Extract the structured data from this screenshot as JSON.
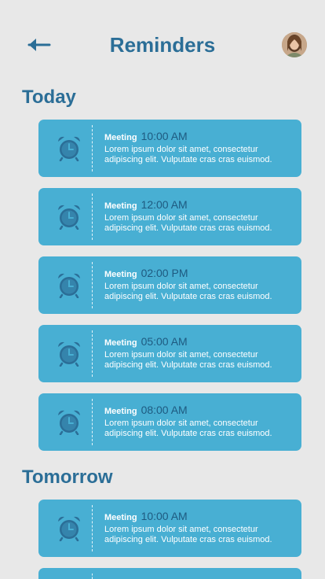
{
  "header": {
    "title": "Reminders",
    "back_icon": "arrow-left-icon",
    "avatar_icon": "user-avatar"
  },
  "sections": [
    {
      "title": "Today",
      "items": [
        {
          "label": "Meeting",
          "time": "10:00 AM",
          "desc": "Lorem ipsum dolor sit amet, consectetur adipiscing elit. Vulputate cras cras euismod."
        },
        {
          "label": "Meeting",
          "time": "12:00 AM",
          "desc": "Lorem ipsum dolor sit amet, consectetur adipiscing elit. Vulputate cras cras euismod."
        },
        {
          "label": "Meeting",
          "time": "02:00 PM",
          "desc": "Lorem ipsum dolor sit amet, consectetur adipiscing elit. Vulputate cras cras euismod."
        },
        {
          "label": "Meeting",
          "time": "05:00 AM",
          "desc": "Lorem ipsum dolor sit amet, consectetur adipiscing elit. Vulputate cras cras euismod."
        },
        {
          "label": "Meeting",
          "time": "08:00 AM",
          "desc": "Lorem ipsum dolor sit amet, consectetur adipiscing elit. Vulputate cras cras euismod."
        }
      ]
    },
    {
      "title": "Tomorrow",
      "items": [
        {
          "label": "Meeting",
          "time": "10:00 AM",
          "desc": "Lorem ipsum dolor sit amet, consectetur adipiscing elit. Vulputate cras cras euismod."
        }
      ]
    }
  ],
  "colors": {
    "background": "#e8e8e8",
    "accent": "#2b6e97",
    "card": "#48afd3",
    "time_text": "#1e5a80"
  }
}
